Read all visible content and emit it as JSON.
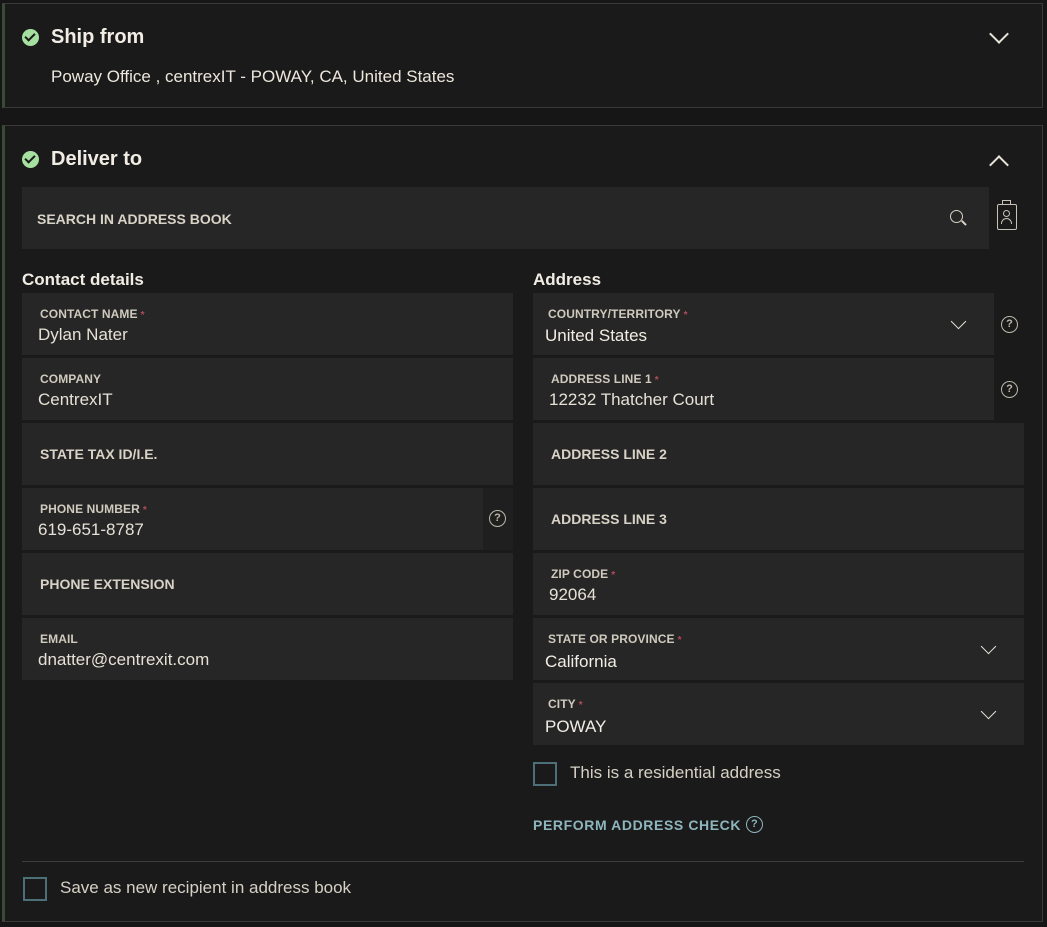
{
  "ship_from": {
    "title": "Ship from",
    "address": "Poway Office , centrexIT - POWAY, CA, United States"
  },
  "deliver_to": {
    "title": "Deliver to",
    "search_placeholder": "SEARCH IN ADDRESS BOOK",
    "contact_heading": "Contact details",
    "address_heading": "Address",
    "contact": {
      "name_label": "CONTACT NAME",
      "name_value": "Dylan Nater",
      "company_label": "COMPANY",
      "company_value": "CentrexIT",
      "tax_label": "STATE TAX ID/I.E.",
      "phone_label": "PHONE NUMBER",
      "phone_value": "619-651-8787",
      "ext_label": "PHONE EXTENSION",
      "email_label": "EMAIL",
      "email_value": "dnatter@centrexit.com"
    },
    "address": {
      "country_label": "COUNTRY/TERRITORY",
      "country_value": "United States",
      "line1_label": "ADDRESS LINE 1",
      "line1_value": "12232 Thatcher Court",
      "line2_label": "ADDRESS LINE 2",
      "line3_label": "ADDRESS LINE 3",
      "zip_label": "ZIP CODE",
      "zip_value": "92064",
      "state_label": "STATE OR PROVINCE",
      "state_value": "California",
      "city_label": "CITY",
      "city_value": "POWAY"
    },
    "residential_label": "This is a residential address",
    "address_check_label": "PERFORM ADDRESS CHECK",
    "save_recipient_label": "Save as new recipient in address book",
    "required_mark": "*",
    "help_glyph": "?"
  },
  "colors": {
    "check_green": "#a6e0a0",
    "required_red": "#b04b5b",
    "link_teal": "#8eb6bd",
    "checkbox_border": "#4c6f78"
  },
  "icons": [
    "check-circle-icon",
    "chevron-down-icon",
    "chevron-up-icon",
    "search-icon",
    "address-book-icon",
    "help-icon"
  ]
}
